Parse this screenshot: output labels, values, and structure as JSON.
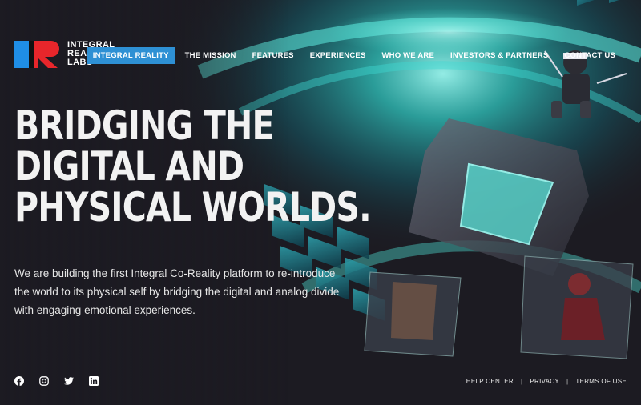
{
  "brand": {
    "line1": "INTEGRAL",
    "line2": "REALITY",
    "line3": "LABS",
    "logo_colors": {
      "blue": "#1f8ee6",
      "red": "#e8262b",
      "black": "#111111"
    }
  },
  "nav": {
    "items": [
      {
        "label": "INTEGRAL REALITY",
        "active": true
      },
      {
        "label": "THE MISSION"
      },
      {
        "label": "FEATURES"
      },
      {
        "label": "EXPERIENCES"
      },
      {
        "label": "WHO WE ARE"
      },
      {
        "label": "INVESTORS & PARTNERS"
      },
      {
        "label": "CONTACT US"
      }
    ],
    "active_color": "#2e90d4"
  },
  "hero": {
    "title_line1": "BRIDGING THE",
    "title_line2": "DIGITAL AND",
    "title_line3": "PHYSICAL WORLDS.",
    "description": "We are building the first Integral Co-Reality platform to re-introduce the world to its physical self by bridging the digital and analog divide with engaging emotional experiences."
  },
  "social": {
    "icons": [
      "facebook-icon",
      "instagram-icon",
      "twitter-icon",
      "linkedin-icon"
    ]
  },
  "footer": {
    "help": "HELP CENTER",
    "privacy": "PRIVACY",
    "terms": "TERMS OF USE",
    "sep": "|"
  },
  "theme": {
    "background": "#1c1b22",
    "accent_teal": "#3fe0d0"
  }
}
